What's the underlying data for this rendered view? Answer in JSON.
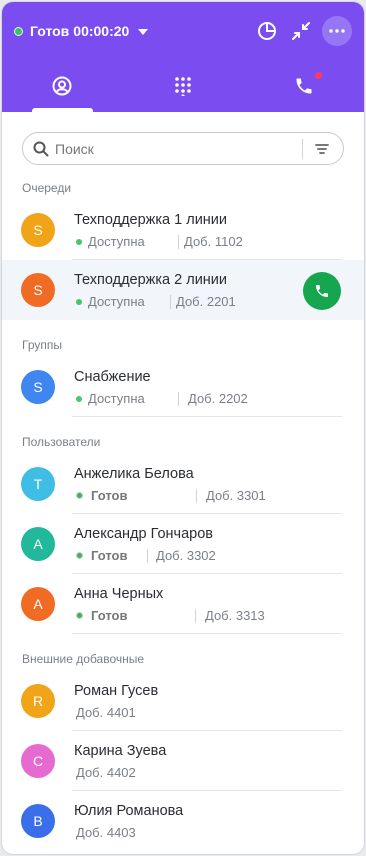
{
  "header": {
    "status": "Готов",
    "timer": "00:00:20",
    "tabs": [
      "contacts-tab",
      "dialpad-tab",
      "calls-tab"
    ]
  },
  "search": {
    "placeholder": "Поиск"
  },
  "sections": {
    "queues": "Очереди",
    "groups": "Группы",
    "users": "Пользователи",
    "external": "Внешние добавочные"
  },
  "queues": [
    {
      "initial": "S",
      "color": "#f0a417",
      "name": "Техподдержка 1 линии",
      "status": "Доступна",
      "ext": "Доб. 1102"
    },
    {
      "initial": "S",
      "color": "#f06b23",
      "name": "Техподдержка 2 линии",
      "status": "Доступна",
      "ext": "Доб. 2201"
    }
  ],
  "groups": [
    {
      "initial": "S",
      "color": "#3f86f0",
      "name": "Снабжение",
      "status": "Доступна",
      "ext": "Доб. 2202"
    }
  ],
  "users": [
    {
      "initial": "T",
      "color": "#3fbde4",
      "name": "Анжелика Белова",
      "status": "Готов",
      "ext": "Доб. 3301"
    },
    {
      "initial": "A",
      "color": "#22b89a",
      "name": "Александр Гончаров",
      "status": "Готов",
      "ext": "Доб. 3302"
    },
    {
      "initial": "A",
      "color": "#f06b23",
      "name": "Анна Черных",
      "status": "Готов",
      "ext": "Доб. 3313"
    }
  ],
  "external": [
    {
      "initial": "R",
      "color": "#f0a417",
      "name": "Роман Гусев",
      "ext": "Доб. 4401"
    },
    {
      "initial": "C",
      "color": "#e56bd0",
      "name": "Карина Зуева",
      "ext": "Доб. 4402"
    },
    {
      "initial": "B",
      "color": "#3a6fe9",
      "name": "Юлия Романова",
      "ext": "Доб. 4403"
    }
  ],
  "colors": {
    "accent": "#7b4cf0",
    "call": "#17a650"
  }
}
